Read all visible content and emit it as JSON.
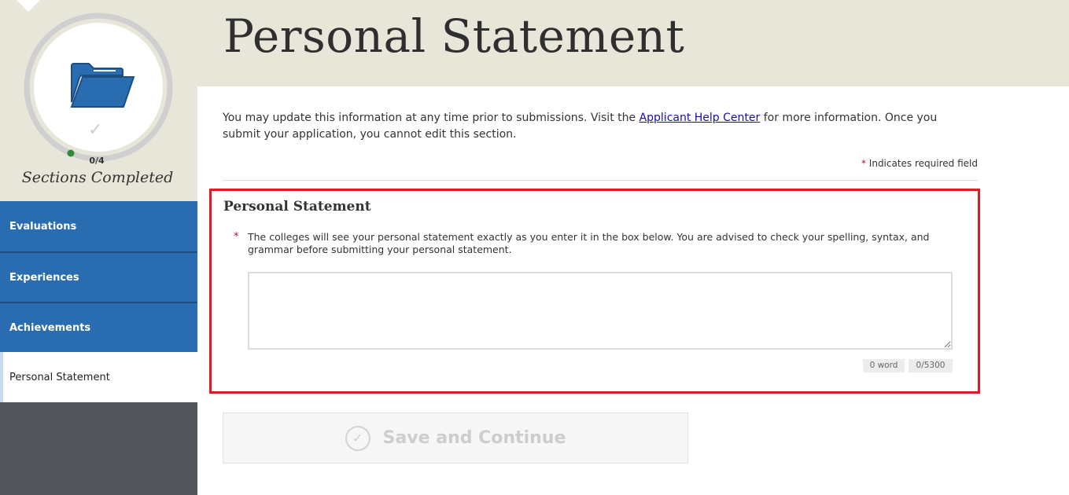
{
  "page": {
    "title": "Personal Statement"
  },
  "sidebar": {
    "progress": {
      "completed": 0,
      "total": 4,
      "text": "0/4",
      "label": "Sections Completed"
    },
    "items": [
      {
        "label": "Evaluations",
        "active": false
      },
      {
        "label": "Experiences",
        "active": false
      },
      {
        "label": "Achievements",
        "active": false
      },
      {
        "label": "Personal Statement",
        "active": true
      }
    ]
  },
  "intro": {
    "before_link": "You may update this information at any time prior to submissions. Visit the ",
    "link_text": "Applicant Help Center",
    "after_link": " for more information. Once you submit your application, you cannot edit this section."
  },
  "required_note": {
    "star": "*",
    "text": " Indicates required field"
  },
  "section": {
    "heading": "Personal Statement",
    "question_star": "*",
    "question": "The colleges will see your personal statement exactly as you enter it in the box below. You are advised to check your spelling, syntax, and grammar before submitting your personal statement.",
    "value": "",
    "word_count": "0 word",
    "char_count": "0/5300"
  },
  "actions": {
    "save_label": "Save and Continue"
  },
  "colors": {
    "header_bg": "#e8e6d9",
    "nav_blue": "#2a6cb0",
    "sidebar_dark": "#52565c",
    "highlight_red": "#e11b22",
    "required_star": "#b0123a"
  },
  "icons": [
    "folder-icon",
    "checkmark-icon",
    "save-check-icon"
  ]
}
